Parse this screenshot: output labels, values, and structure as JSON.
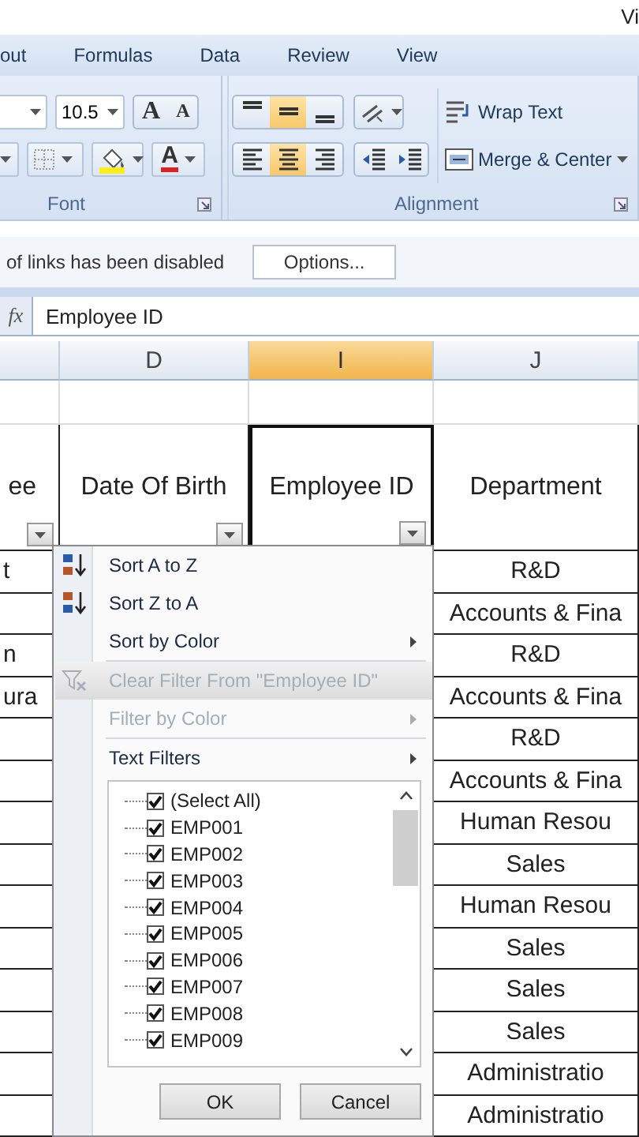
{
  "title_bar": {
    "text": "Vi"
  },
  "ribbon_tabs": [
    {
      "label": "out"
    },
    {
      "label": "Formulas"
    },
    {
      "label": "Data"
    },
    {
      "label": "Review"
    },
    {
      "label": "View"
    }
  ],
  "font_group": {
    "label": "Font",
    "font_size": "10.5",
    "grow_font": "A",
    "shrink_font": "A",
    "font_color": "A"
  },
  "alignment_group": {
    "label": "Alignment",
    "vertical_buttons": [
      {
        "kind": "top",
        "selected": false
      },
      {
        "kind": "middle",
        "selected": true
      },
      {
        "kind": "bottom",
        "selected": false
      }
    ],
    "horizontal_buttons": [
      {
        "kind": "left",
        "selected": false
      },
      {
        "kind": "center",
        "selected": true
      },
      {
        "kind": "right",
        "selected": false
      }
    ],
    "wrap_text": "Wrap Text",
    "merge_center": "Merge & Center"
  },
  "message_bar": {
    "text": "of links has been disabled",
    "button": "Options..."
  },
  "formula_bar": {
    "function_label": "fx",
    "value": "Employee ID"
  },
  "columns": [
    {
      "selected": false
    },
    {
      "label": "D",
      "selected": false
    },
    {
      "label": "I",
      "selected": true
    },
    {
      "label": "J",
      "selected": false
    }
  ],
  "header_row": [
    {
      "text": "ee",
      "filter": true,
      "selected": false
    },
    {
      "text": "Date Of Birth",
      "filter": true,
      "selected": false
    },
    {
      "text": "Employee ID",
      "filter": true,
      "selected": true
    },
    {
      "text": "Department",
      "filter": false,
      "selected": false
    }
  ],
  "rows": [
    {
      "column_1": "t",
      "department": "R&D"
    },
    {
      "column_1": "",
      "department": "Accounts & Fina"
    },
    {
      "column_1": "n",
      "department": "R&D"
    },
    {
      "column_1": "ura",
      "department": "Accounts & Fina"
    },
    {
      "column_1": "",
      "department": "R&D"
    },
    {
      "column_1": "",
      "department": "Accounts & Fina"
    },
    {
      "column_1": "",
      "department": "Human Resou"
    },
    {
      "column_1": "",
      "department": "Sales"
    },
    {
      "column_1": "",
      "department": "Human Resou"
    },
    {
      "column_1": "",
      "department": "Sales"
    },
    {
      "column_1": "",
      "department": "Sales"
    },
    {
      "column_1": "",
      "department": "Sales"
    },
    {
      "column_1": "",
      "department": "Administratio"
    },
    {
      "column_1": "",
      "department": "Administratio"
    }
  ],
  "filter_menu": {
    "items": [
      {
        "kind": "sort_ascending",
        "label": "Sort A to Z",
        "disabled": false,
        "submenu": false,
        "highlighted": false
      },
      {
        "kind": "sort_descending",
        "label": "Sort Z to A",
        "disabled": false,
        "submenu": false,
        "highlighted": false
      },
      {
        "kind": "plain",
        "label": "Sort by Color",
        "disabled": false,
        "submenu": true,
        "highlighted": false
      },
      {
        "kind": "clear_filter",
        "label": "Clear Filter From \"Employee ID\"",
        "disabled": true,
        "submenu": false,
        "highlighted": true
      },
      {
        "kind": "plain",
        "label": "Filter by Color",
        "disabled": true,
        "submenu": true,
        "highlighted": false
      },
      {
        "kind": "plain",
        "label": "Text Filters",
        "disabled": false,
        "submenu": true,
        "highlighted": false
      }
    ],
    "values": [
      {
        "label": "(Select All)",
        "checked": true
      },
      {
        "label": "EMP001",
        "checked": true
      },
      {
        "label": "EMP002",
        "checked": true
      },
      {
        "label": "EMP003",
        "checked": true
      },
      {
        "label": "EMP004",
        "checked": true
      },
      {
        "label": "EMP005",
        "checked": true
      },
      {
        "label": "EMP006",
        "checked": true
      },
      {
        "label": "EMP007",
        "checked": true
      },
      {
        "label": "EMP008",
        "checked": true
      },
      {
        "label": "EMP009",
        "checked": true
      }
    ],
    "buttons": [
      "OK",
      "Cancel"
    ]
  }
}
